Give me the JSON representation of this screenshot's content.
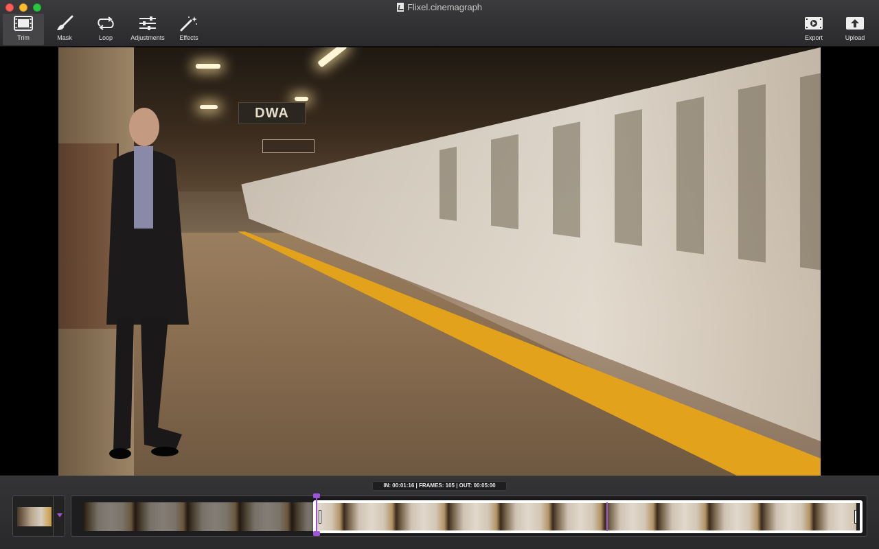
{
  "window": {
    "title": "Flixel.cinemagraph"
  },
  "toolbar": {
    "left_tools": [
      {
        "label": "Trim",
        "icon": "film-trim-icon",
        "active": true
      },
      {
        "label": "Mask",
        "icon": "brush-icon",
        "active": false
      },
      {
        "label": "Loop",
        "icon": "loop-icon",
        "active": false
      },
      {
        "label": "Adjustments",
        "icon": "sliders-icon",
        "active": false
      },
      {
        "label": "Effects",
        "icon": "magic-wand-icon",
        "active": false
      }
    ],
    "right_tools": [
      {
        "label": "Export",
        "icon": "export-film-icon"
      },
      {
        "label": "Upload",
        "icon": "upload-icon"
      }
    ]
  },
  "video": {
    "sign_text": "DWA"
  },
  "timeline": {
    "readout": "IN: 00:01:16 | FRAMES: 105 | OUT: 00:05:00",
    "in_point": "00:01:16",
    "frames": 105,
    "out_point": "00:05:00"
  },
  "colors": {
    "accent": "#9b55d6",
    "toolbar_bg": "#2f2f31",
    "timeline_bg": "#2c2c2e"
  }
}
